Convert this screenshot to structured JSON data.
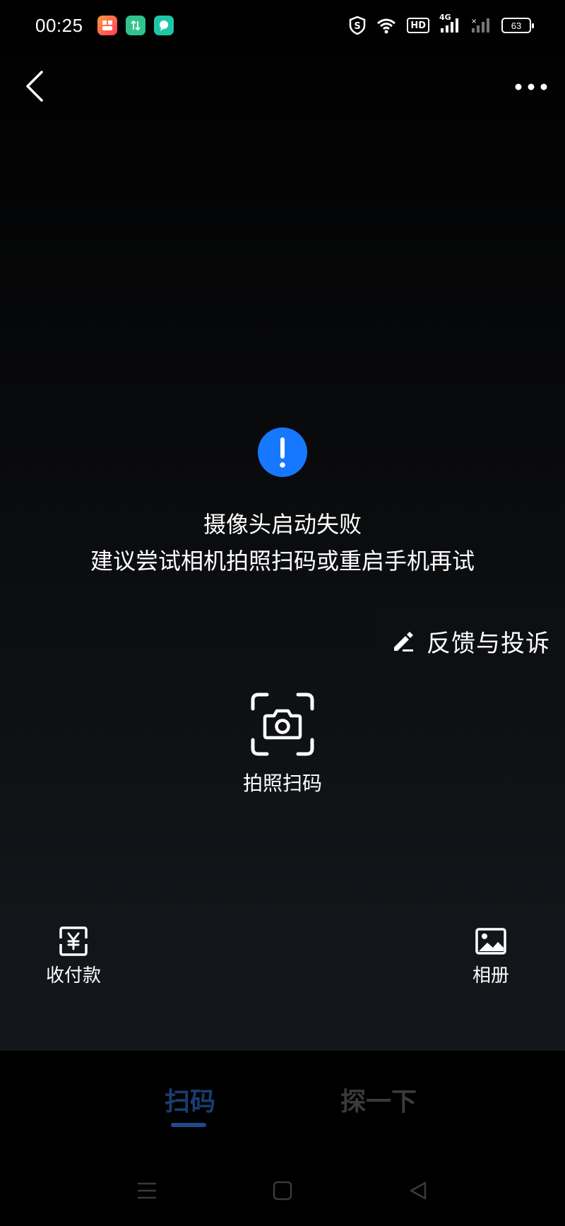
{
  "status_bar": {
    "time": "00:25",
    "battery": "63",
    "network_label": "4G",
    "hd_label": "HD"
  },
  "header": {
    "back_icon": "chevron-left-icon",
    "more_icon": "more-dots-icon"
  },
  "error": {
    "icon": "exclamation-icon",
    "title": "摄像头启动失败",
    "subtitle": "建议尝试相机拍照扫码或重启手机再试",
    "accent_color": "#1677ff"
  },
  "feedback": {
    "label": "反馈与投诉",
    "icon": "pen-edit-icon"
  },
  "photo_scan": {
    "label": "拍照扫码",
    "icon": "camera-scan-icon"
  },
  "actions": {
    "payment_label": "收付款",
    "payment_icon": "yuan-icon",
    "album_label": "相册",
    "album_icon": "image-icon"
  },
  "tabs": [
    {
      "label": "扫码",
      "active": true
    },
    {
      "label": "探一下",
      "active": false
    }
  ],
  "nav": {
    "menu_icon": "menu-icon",
    "home_icon": "home-square-icon",
    "back_icon": "back-triangle-icon"
  }
}
